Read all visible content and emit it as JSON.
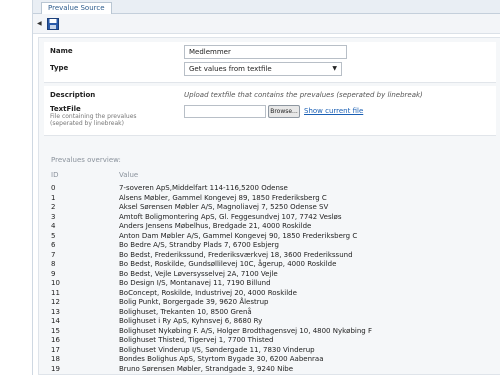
{
  "tab": {
    "label": "Prevalue Source"
  },
  "form": {
    "name_label": "Name",
    "name_value": "Medlemmer",
    "type_label": "Type",
    "type_value": "Get values from textfile",
    "description_label": "Description",
    "description_text": "Upload textfile that contains the prevalues (seperated by linebreak)",
    "textfile_label": "TextFile",
    "textfile_hint": "File containing the prevalues (seperated by linebreak)",
    "browse_label": "Browse...",
    "show_file_link": "Show current file"
  },
  "overview": {
    "title": "Prevalues overview:",
    "id_header": "ID",
    "value_header": "Value",
    "rows": [
      {
        "id": "0",
        "value": "7-soveren ApS,Middelfart 114-116,5200 Odense"
      },
      {
        "id": "1",
        "value": "Alsens Møbler, Gammel Kongevej 89, 1850 Frederiksberg C"
      },
      {
        "id": "2",
        "value": "Aksel Sørensen Møbler A/S, Magnoliavej 7, 5250 Odense SV"
      },
      {
        "id": "3",
        "value": "Amtoft Boligmontering ApS, Gl. Feggesundvej 107, 7742 Vesløs"
      },
      {
        "id": "4",
        "value": "Anders Jensens Møbelhus, Bredgade 21, 4000 Roskilde"
      },
      {
        "id": "5",
        "value": "Anton Dam Møbler A/S, Gammel Kongevej 90, 1850 Frederiksberg C"
      },
      {
        "id": "6",
        "value": "Bo Bedre A/S, Strandby Plads 7, 6700 Esbjerg"
      },
      {
        "id": "7",
        "value": "Bo Bedst, Frederikssund, Frederiksværkvej 18, 3600 Frederikssund"
      },
      {
        "id": "8",
        "value": "Bo Bedst, Roskilde, Gundsøllilevej 10C, ågerup, 4000 Roskilde"
      },
      {
        "id": "9",
        "value": "Bo Bedst, Vejle Løversysselvej 2A, 7100 Vejle"
      },
      {
        "id": "10",
        "value": "Bo Design I/S, Montanavej 11, 7190 Billund"
      },
      {
        "id": "11",
        "value": "BoConcept, Roskilde, Industrivej 20, 4000 Roskilde"
      },
      {
        "id": "12",
        "value": "Bolig Punkt, Borgergade 39, 9620 Ålestrup"
      },
      {
        "id": "13",
        "value": "Bolighuset, Trekanten 10, 8500 Grenå"
      },
      {
        "id": "14",
        "value": "Bolighuset i Ry ApS, Kyhnsvej 6, 8680 Ry"
      },
      {
        "id": "15",
        "value": "Bolighuset Nykøbing F. A/S, Holger Brodthagensvej 10, 4800 Nykøbing F"
      },
      {
        "id": "16",
        "value": "Bolighuset Thisted, Tigervej 1, 7700 Thisted"
      },
      {
        "id": "17",
        "value": "Bolighuset Vinderup I/S, Søndergade 11, 7830 Vinderup"
      },
      {
        "id": "18",
        "value": "Bondes Bolighus ApS, Styrtom Bygade 30, 6200 Aabenraa"
      },
      {
        "id": "19",
        "value": "Bruno Sørensen Møbler, Strandgade 3, 9240 Nibe"
      }
    ]
  }
}
